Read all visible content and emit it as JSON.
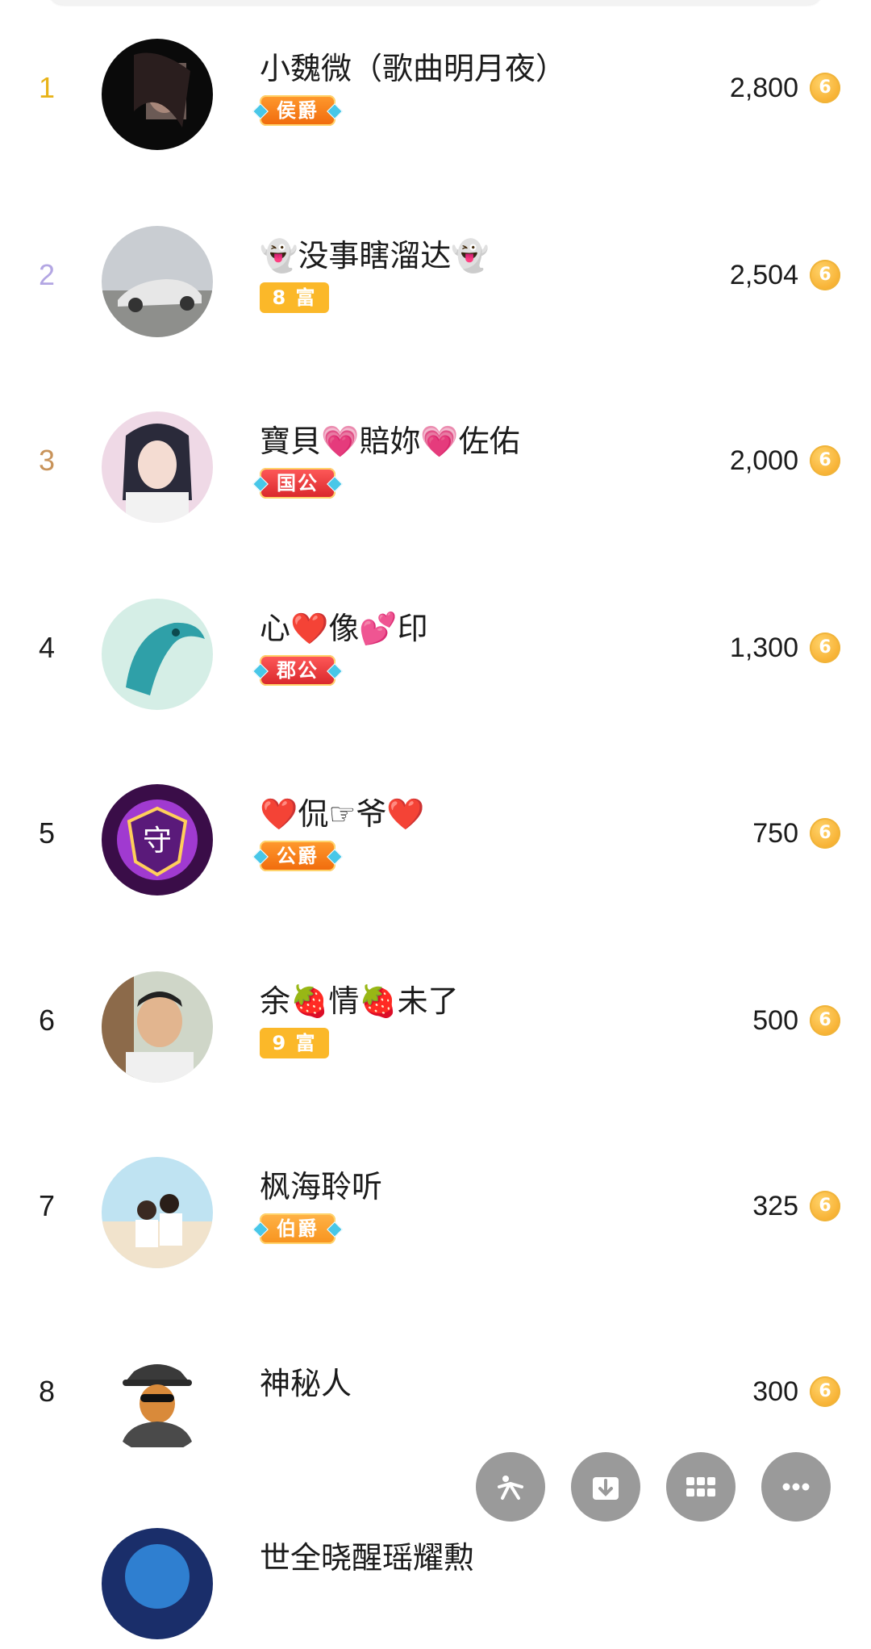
{
  "colors": {
    "rank_1": "#e8b318",
    "rank_2": "#b3a6e3",
    "rank_3": "#c8935a",
    "rank_default": "#1b1b1b",
    "coin": "#f4a21b",
    "fab": "#9a9a9a"
  },
  "rows": [
    {
      "rank": "1",
      "name": "小魏微（歌曲明月夜）",
      "badge": "侯爵",
      "badge_type": "noble",
      "amount": "2,800"
    },
    {
      "rank": "2",
      "name": "👻没事瞎溜达👻",
      "badge": "8 富",
      "badge_type": "rich",
      "amount": "2,504"
    },
    {
      "rank": "3",
      "name": "寶貝💗賠妳💗佐佑",
      "badge": "国公",
      "badge_type": "noble-red",
      "amount": "2,000"
    },
    {
      "rank": "4",
      "name": "心❤️像💕印",
      "badge": "郡公",
      "badge_type": "noble-red",
      "amount": "1,300"
    },
    {
      "rank": "5",
      "name": "❤️侃☞爷❤️",
      "badge": "公爵",
      "badge_type": "noble",
      "amount": "750"
    },
    {
      "rank": "6",
      "name": "余🍓情🍓未了",
      "badge": "9 富",
      "badge_type": "rich",
      "amount": "500"
    },
    {
      "rank": "7",
      "name": "枫海聆听",
      "badge": "伯爵",
      "badge_type": "noble-gold",
      "amount": "325"
    },
    {
      "rank": "8",
      "name": "神秘人",
      "badge": "",
      "badge_type": "none",
      "amount": "300"
    },
    {
      "rank": "",
      "name": "世全晓醒瑶耀勲",
      "badge": "",
      "badge_type": "none",
      "amount": ""
    }
  ],
  "coin_symbol": "6",
  "fab_buttons": [
    {
      "icon": "kuaishou-share-icon"
    },
    {
      "icon": "download-icon"
    },
    {
      "icon": "grid-icon"
    },
    {
      "icon": "more-icon"
    }
  ]
}
